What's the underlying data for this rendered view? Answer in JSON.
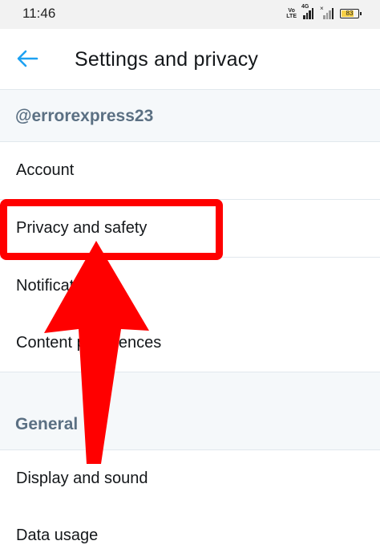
{
  "status_bar": {
    "time": "11:46",
    "volte_label": "Vo LTE",
    "network_label": "4G",
    "battery_level": "83"
  },
  "app_bar": {
    "title": "Settings and privacy"
  },
  "account_section": {
    "handle": "@errorexpress23",
    "items": [
      {
        "label": "Account"
      },
      {
        "label": "Privacy and safety"
      },
      {
        "label": "Notifications"
      },
      {
        "label": "Content preferences"
      }
    ]
  },
  "general_section": {
    "header": "General",
    "items": [
      {
        "label": "Display and sound"
      },
      {
        "label": "Data usage"
      }
    ]
  },
  "colors": {
    "accent": "#1da1f2",
    "annotation": "#ff0000",
    "section_bg": "#f5f8fa",
    "section_text": "#5b7083"
  },
  "icons": {
    "back": "arrow-left-icon",
    "signal": "signal-icon",
    "battery": "battery-icon"
  }
}
